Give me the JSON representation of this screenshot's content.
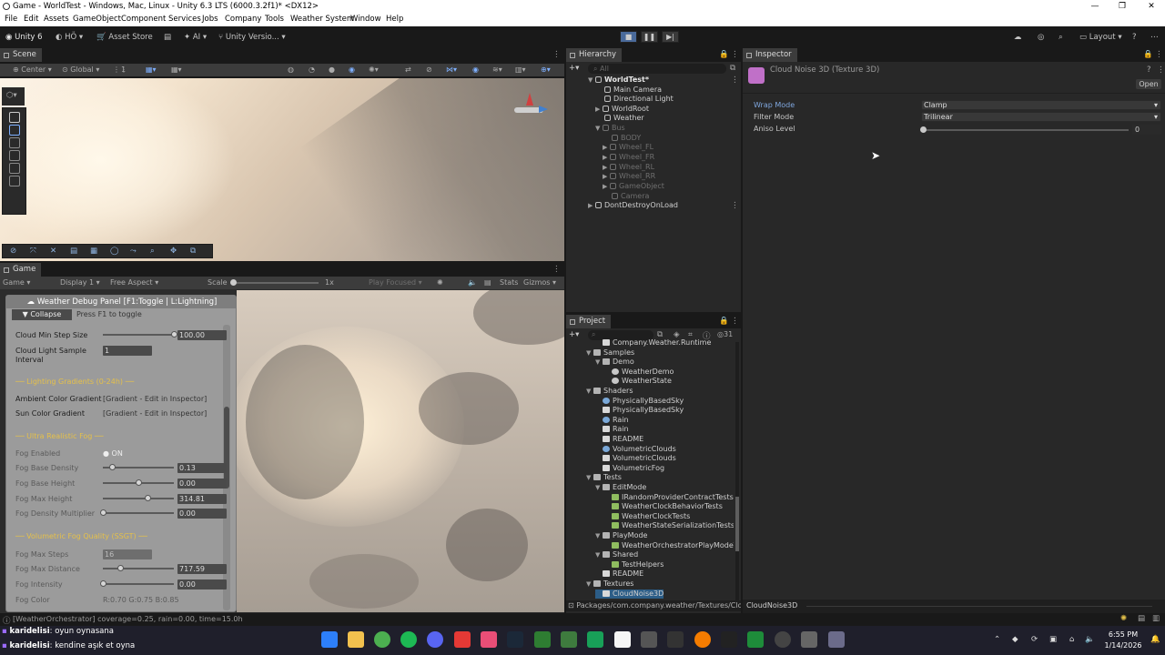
{
  "window": {
    "title": "Game - WorldTest - Windows, Mac, Linux - Unity 6.3 LTS (6000.3.2f1)* <DX12>",
    "min_icon": "minimize-icon",
    "max_icon": "maximize-icon",
    "close_icon": "close-icon"
  },
  "menu": [
    "File",
    "Edit",
    "Assets",
    "GameObject",
    "Component",
    "Services",
    "Jobs",
    "Company",
    "Tools",
    "Weather System",
    "Window",
    "Help"
  ],
  "toolbar": {
    "account": "Unity 6",
    "user": "HÖ",
    "asset_store": "Asset Store",
    "ai": "AI",
    "version_control": "Unity Versio...",
    "layout": "Layout"
  },
  "scene_tab": {
    "label": "Scene",
    "pivot": "Center",
    "space": "Global",
    "grid_snap": "1"
  },
  "game_tab": {
    "label": "Game",
    "mode": "Game",
    "display": "Display 1",
    "aspect": "Free Aspect",
    "scale_label": "Scale",
    "scale_value": "1x",
    "play_focused": "Play Focused",
    "stats": "Stats",
    "gizmos": "Gizmos"
  },
  "debug_panel": {
    "title": "Weather Debug Panel [F1:Toggle | L:Lightning]",
    "collapse": "▼ Collapse",
    "hint": "Press F1 to toggle",
    "cloud_min_step_label": "Cloud Min Step Size",
    "cloud_min_step_value": "100.00",
    "cloud_min_step_level": 1.0,
    "cloud_light_label": "Cloud Light Sample Interval",
    "cloud_light_value": "1",
    "lighting_section": "── Lighting Gradients (0-24h) ──",
    "ambient_label": "Ambient Color Gradient",
    "ambient_value": "[Gradient - Edit in Inspector]",
    "sun_label": "Sun Color Gradient",
    "sun_value": "[Gradient - Edit in Inspector]",
    "fog_section": "── Ultra Realistic Fog ──",
    "fog_enabled_label": "Fog Enabled",
    "fog_enabled_value": "ON",
    "fog_density_label": "Fog Base Density",
    "fog_density_value": "0.13",
    "fog_density_level": 0.13,
    "fog_height_label": "Fog Base Height",
    "fog_height_value": "0.00",
    "fog_height_level": 0.5,
    "fog_max_height_label": "Fog Max Height",
    "fog_max_height_value": "314.81",
    "fog_max_height_level": 0.63,
    "fog_density_mult_label": "Fog Density Multiplier",
    "fog_density_mult_value": "0.00",
    "fog_density_mult_level": 0.0,
    "vol_section": "── Volumetric Fog Quality (SSGT) ──",
    "fog_steps_label": "Fog Max Steps",
    "fog_steps_value": "16",
    "fog_distance_label": "Fog Max Distance",
    "fog_distance_value": "717.59",
    "fog_distance_level": 0.24,
    "fog_intensity_label": "Fog Intensity",
    "fog_intensity_value": "0.00",
    "fog_intensity_level": 0.0,
    "fog_color_label": "Fog Color",
    "fog_color_value": "R:0.70 G:0.75 B:0.85"
  },
  "hierarchy": {
    "tab": "Hierarchy",
    "search_placeholder": "All",
    "root": "WorldTest*",
    "items": [
      "Main Camera",
      "Directional Light",
      "WorldRoot",
      "Weather"
    ],
    "bus": "Bus",
    "bus_items": [
      "BODY",
      "Wheel_FL",
      "Wheel_FR",
      "Wheel_RL",
      "Wheel_RR",
      "GameObject",
      "Camera"
    ],
    "ddol": "DontDestroyOnLoad"
  },
  "project": {
    "tab": "Project",
    "count": "31",
    "rows": [
      {
        "t": "Company.Weather.Runtime",
        "i": "doc",
        "d": 1,
        "a": ""
      },
      {
        "t": "Samples",
        "i": "folder",
        "d": 0,
        "a": "▼"
      },
      {
        "t": "Demo",
        "i": "folder",
        "d": 1,
        "a": "▼"
      },
      {
        "t": "WeatherDemo",
        "i": "unity",
        "d": 2,
        "a": ""
      },
      {
        "t": "WeatherState",
        "i": "unity",
        "d": 2,
        "a": ""
      },
      {
        "t": "Shaders",
        "i": "folder",
        "d": 0,
        "a": "▼"
      },
      {
        "t": "PhysicallyBasedSky",
        "i": "shader",
        "d": 1,
        "a": ""
      },
      {
        "t": "PhysicallyBasedSky",
        "i": "doc",
        "d": 1,
        "a": ""
      },
      {
        "t": "Rain",
        "i": "shader",
        "d": 1,
        "a": ""
      },
      {
        "t": "Rain",
        "i": "doc",
        "d": 1,
        "a": ""
      },
      {
        "t": "README",
        "i": "doc",
        "d": 1,
        "a": ""
      },
      {
        "t": "VolumetricClouds",
        "i": "shader",
        "d": 1,
        "a": ""
      },
      {
        "t": "VolumetricClouds",
        "i": "doc",
        "d": 1,
        "a": ""
      },
      {
        "t": "VolumetricFog",
        "i": "doc",
        "d": 1,
        "a": ""
      },
      {
        "t": "Tests",
        "i": "folder",
        "d": 0,
        "a": "▼"
      },
      {
        "t": "EditMode",
        "i": "folder",
        "d": 1,
        "a": "▼"
      },
      {
        "t": "IRandomProviderContractTests",
        "i": "cs",
        "d": 2,
        "a": ""
      },
      {
        "t": "WeatherClockBehaviorTests",
        "i": "cs",
        "d": 2,
        "a": ""
      },
      {
        "t": "WeatherClockTests",
        "i": "cs",
        "d": 2,
        "a": ""
      },
      {
        "t": "WeatherStateSerializationTests",
        "i": "cs",
        "d": 2,
        "a": ""
      },
      {
        "t": "PlayMode",
        "i": "folder",
        "d": 1,
        "a": "▼"
      },
      {
        "t": "WeatherOrchestratorPlayModeTe",
        "i": "cs",
        "d": 2,
        "a": ""
      },
      {
        "t": "Shared",
        "i": "folder",
        "d": 1,
        "a": "▼"
      },
      {
        "t": "TestHelpers",
        "i": "cs",
        "d": 2,
        "a": ""
      },
      {
        "t": "README",
        "i": "doc",
        "d": 1,
        "a": ""
      },
      {
        "t": "Textures",
        "i": "folder",
        "d": 0,
        "a": "▼"
      },
      {
        "t": "CloudNoise3D",
        "i": "doc",
        "d": 1,
        "a": ""
      }
    ],
    "path": "Packages/com.company.weather/Textures/Clou"
  },
  "inspector": {
    "tab": "Inspector",
    "asset_title": "Cloud Noise 3D (Texture 3D)",
    "open": "Open",
    "wrap_label": "Wrap Mode",
    "wrap_value": "Clamp",
    "filter_label": "Filter Mode",
    "filter_value": "Trilinear",
    "aniso_label": "Aniso Level",
    "aniso_value": "0",
    "footer": "CloudNoise3D"
  },
  "status": {
    "message": "[WeatherOrchestrator] coverage=0.25, rain=0.00, time=15.0h"
  },
  "chat": [
    {
      "name": "karidelisi",
      "text": ": oyun oynasana"
    },
    {
      "name": "karidelisi",
      "text": ": kendine aşık et oyna"
    }
  ],
  "taskbar": {
    "time": "6:55 PM",
    "date": "1/14/2026"
  }
}
